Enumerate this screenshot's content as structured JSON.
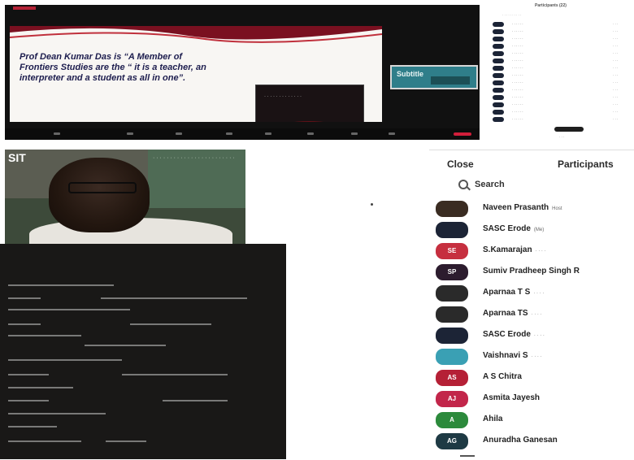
{
  "shared_screen": {
    "slide_text": "Prof Dean Kumar Das is “A Member of Frontiers Studies are the “ it is a teacher, an interpreter and a student as all in one”.",
    "video_caption": "· · · · · · · · · · · · ·",
    "thumbnail_label": "Subtitle"
  },
  "participants_mini": {
    "title": "Participants (22)",
    "subtitle": "· · · · · · · · · ·",
    "rows": [
      {
        "name": "· · · · · ·",
        "status": "· · ·"
      },
      {
        "name": "· · · · · ·",
        "status": "· · ·"
      },
      {
        "name": "· · · · · ·",
        "status": "· · ·"
      },
      {
        "name": "· · · · · ·",
        "status": "· · ·"
      },
      {
        "name": "· · · · · ·",
        "status": "· · ·"
      },
      {
        "name": "· · · · · ·",
        "status": "· · ·"
      },
      {
        "name": "· · · · · ·",
        "status": "· · ·"
      },
      {
        "name": "· · · · · ·",
        "status": "· · ·"
      },
      {
        "name": "· · · · · ·",
        "status": "· · ·"
      },
      {
        "name": "· · · · · ·",
        "status": "· · ·"
      },
      {
        "name": "· · · · · ·",
        "status": "· · ·"
      },
      {
        "name": "· · · · · ·",
        "status": "· · ·"
      },
      {
        "name": "· · · · · ·",
        "status": "· · ·"
      },
      {
        "name": "· · · · · ·",
        "status": "· · ·"
      }
    ],
    "more_label": "· · ·"
  },
  "video": {
    "wall_text": "SIT",
    "chalkboard_text": "· · · · · · · · · · · · · · · · · · · · · · · ·"
  },
  "participants_panel": {
    "tabs": [
      "Close",
      "Participants"
    ],
    "search_label": "Search",
    "participants": [
      {
        "avatar": "",
        "name": "Naveen Prasanth",
        "sub": "Host",
        "color": "#3a2c22"
      },
      {
        "avatar": "",
        "name": "SASC Erode",
        "sub": "(Me)",
        "color": "#1c2436"
      },
      {
        "avatar": "SE",
        "name": "S.Kamarajan",
        "sub": "· · · ·",
        "color": "#c62f3f"
      },
      {
        "avatar": "SP",
        "name": "Sumiv Pradheep Singh R",
        "sub": "",
        "color": "#2c1c2e"
      },
      {
        "avatar": "",
        "name": "Aparnaa T S",
        "sub": "· · · ·",
        "color": "#2a2a2a"
      },
      {
        "avatar": "",
        "name": "Aparnaa TS",
        "sub": "· · · ·",
        "color": "#2a2a2a"
      },
      {
        "avatar": "",
        "name": "SASC Erode",
        "sub": "· · · ·",
        "color": "#1c2436"
      },
      {
        "avatar": "",
        "name": "Vaishnavi S",
        "sub": "· · · ·",
        "color": "#3aa0b4"
      },
      {
        "avatar": "AS",
        "name": "A S Chitra",
        "sub": "",
        "color": "#b52036"
      },
      {
        "avatar": "AJ",
        "name": "Asmita Jayesh",
        "sub": "",
        "color": "#c2264a"
      },
      {
        "avatar": "A",
        "name": "Ahila",
        "sub": "",
        "color": "#2c8a3c"
      },
      {
        "avatar": "AG",
        "name": "Anuradha Ganesan",
        "sub": "",
        "color": "#1e3a44"
      }
    ]
  }
}
